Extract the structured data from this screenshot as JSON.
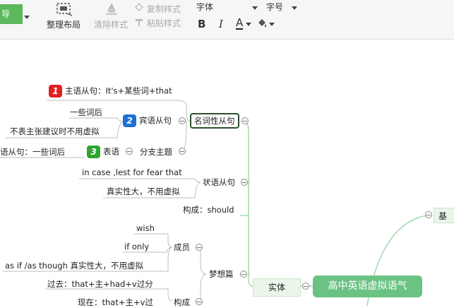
{
  "toolbar": {
    "green_button_label": "导",
    "layout_label": "整理布局",
    "clear_style_label": "清除样式",
    "copy_style_label": "复制样式",
    "paste_style_label": "粘贴样式",
    "font_label": "字体",
    "font_size_label": "字号",
    "bold_label": "B",
    "italic_label": "I",
    "font_color_label": "A"
  },
  "mindmap": {
    "root": "高中英语虚拟语气",
    "main_branch": "实体",
    "right_partial": "基",
    "branches": {
      "noun_clause": "名词性从句",
      "subject_clause": "主语从句：It's+某些词+that",
      "object_clause": "宾语从句",
      "object_a": "一些词后",
      "object_b": "不表主张建议时不用虚拟",
      "predicative": "表语",
      "predicative_left": "语从句：一些词后",
      "appositive": "分支主题",
      "adverbial_clause": "状语从句",
      "adverbial_a": "in case ,lest for  fear  that",
      "adverbial_b": "真实性大，不用虚拟",
      "composition_should": "构成：should",
      "dream": "梦想篇",
      "members": "成员",
      "members_wish": "wish",
      "members_if_only": "if  only",
      "members_as_if": "as  if /as  though  真实性大，不用虚拟",
      "composition": "构成",
      "comp_past": "过去：that+主+had+v过分",
      "comp_now": "现在：that+主+v过"
    },
    "badges": [
      "1",
      "2",
      "3"
    ]
  },
  "colors": {
    "root_bg": "#6cc283",
    "line": "#8fd39a",
    "badge1": "#e02020",
    "badge2": "#1f6fd6",
    "badge3": "#2fa52f"
  }
}
